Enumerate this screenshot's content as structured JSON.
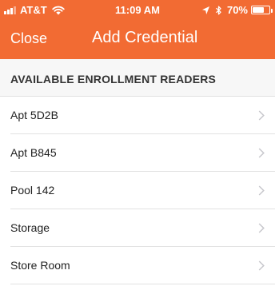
{
  "status_bar": {
    "carrier": "AT&T",
    "time": "11:09 AM",
    "battery": "70%",
    "battery_level": 0.7
  },
  "nav": {
    "close_label": "Close",
    "title": "Add Credential"
  },
  "section": {
    "title": "AVAILABLE ENROLLMENT READERS"
  },
  "readers": [
    {
      "label": "Apt 5D2B"
    },
    {
      "label": "Apt B845"
    },
    {
      "label": "Pool 142"
    },
    {
      "label": "Storage"
    },
    {
      "label": "Store Room"
    }
  ],
  "colors": {
    "header": "#F26B33",
    "section_background": "#f7f7f7",
    "divider": "#e2e2e2",
    "chevron": "#c7c7cc"
  }
}
